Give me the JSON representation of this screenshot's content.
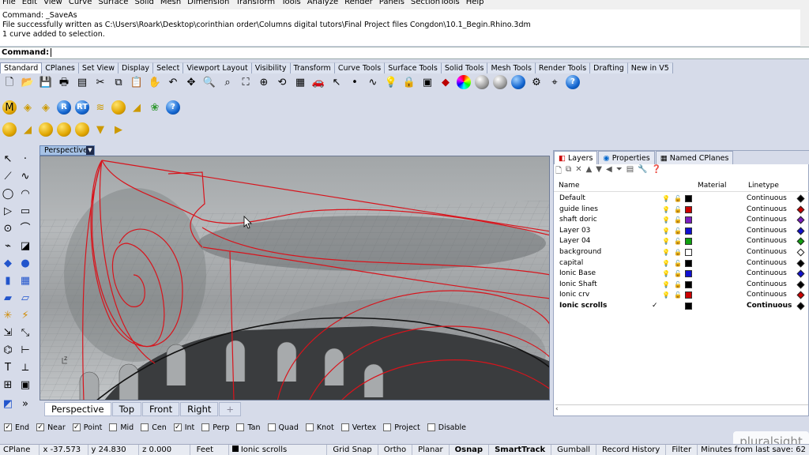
{
  "menu": [
    "File",
    "Edit",
    "View",
    "Curve",
    "Surface",
    "Solid",
    "Mesh",
    "Dimension",
    "Transform",
    "Tools",
    "Analyze",
    "Render",
    "Panels",
    "SectionTools",
    "Help"
  ],
  "command_history": [
    "Command: _SaveAs",
    "File successfully written as C:\\Users\\Roark\\Desktop\\corinthian order\\Columns digital tutors\\Final Project files Congdon\\10.1_Begin.Rhino.3dm",
    "1 curve added to selection."
  ],
  "command_prompt": "Command:",
  "toolbar_tabs": [
    "Standard",
    "CPlanes",
    "Set View",
    "Display",
    "Select",
    "Viewport Layout",
    "Visibility",
    "Transform",
    "Curve Tools",
    "Surface Tools",
    "Solid Tools",
    "Mesh Tools",
    "Render Tools",
    "Drafting",
    "New in V5"
  ],
  "toolbar_tabs_active": 0,
  "viewport": {
    "title": "Perspective",
    "tabs": [
      "Perspective",
      "Top",
      "Front",
      "Right"
    ],
    "add_tab_glyph": "+",
    "axis_label": "z"
  },
  "panel": {
    "tabs": [
      "Layers",
      "Properties",
      "Named CPlanes"
    ],
    "columns": [
      "Name",
      "Material",
      "Linetype"
    ],
    "layers": [
      {
        "name": "Default",
        "color": "#000000",
        "linetype": "Continuous",
        "locked": false,
        "current": false
      },
      {
        "name": "guide lines",
        "color": "#cc0000",
        "linetype": "Continuous",
        "locked": false,
        "current": false
      },
      {
        "name": "shaft doric",
        "color": "#7a1fc0",
        "linetype": "Continuous",
        "locked": false,
        "current": false
      },
      {
        "name": "Layer 03",
        "color": "#1010d0",
        "linetype": "Continuous",
        "locked": false,
        "current": false
      },
      {
        "name": "Layer 04",
        "color": "#10a010",
        "linetype": "Continuous",
        "locked": false,
        "current": false
      },
      {
        "name": "background",
        "color": "#ffffff",
        "linetype": "Continuous",
        "locked": true,
        "current": false
      },
      {
        "name": "capital",
        "color": "#000000",
        "linetype": "Continuous",
        "locked": false,
        "current": false
      },
      {
        "name": "Ionic Base",
        "color": "#1010d0",
        "linetype": "Continuous",
        "locked": false,
        "current": false
      },
      {
        "name": "Ionic Shaft",
        "color": "#000000",
        "linetype": "Continuous",
        "locked": false,
        "current": false
      },
      {
        "name": "Ionic crv",
        "color": "#cc0000",
        "linetype": "Continuous",
        "locked": false,
        "current": false
      },
      {
        "name": "Ionic scrolls",
        "color": "#000000",
        "linetype": "Continuous",
        "locked": false,
        "current": true
      }
    ],
    "current_check": "✓"
  },
  "osnaps": [
    {
      "label": "End",
      "checked": true
    },
    {
      "label": "Near",
      "checked": true
    },
    {
      "label": "Point",
      "checked": true
    },
    {
      "label": "Mid",
      "checked": false
    },
    {
      "label": "Cen",
      "checked": false
    },
    {
      "label": "Int",
      "checked": true
    },
    {
      "label": "Perp",
      "checked": false
    },
    {
      "label": "Tan",
      "checked": false
    },
    {
      "label": "Quad",
      "checked": false
    },
    {
      "label": "Knot",
      "checked": false
    },
    {
      "label": "Vertex",
      "checked": false
    },
    {
      "label": "Project",
      "checked": false
    },
    {
      "label": "Disable",
      "checked": false
    }
  ],
  "status": {
    "cplane": "CPlane",
    "x": "x -37.573",
    "y": "y 24.830",
    "z": "z 0.000",
    "units": "Feet",
    "layer": "Ionic scrolls",
    "buttons": [
      "Grid Snap",
      "Ortho",
      "Planar",
      "Osnap",
      "SmartTrack",
      "Gumball",
      "Record History",
      "Filter"
    ],
    "bold_buttons": [
      "Osnap",
      "SmartTrack"
    ],
    "last_save": "Minutes from last save: 62"
  },
  "watermark": "pluralsight",
  "colors": {
    "curve": "#d8141c",
    "accent": "#a6c2e6"
  }
}
